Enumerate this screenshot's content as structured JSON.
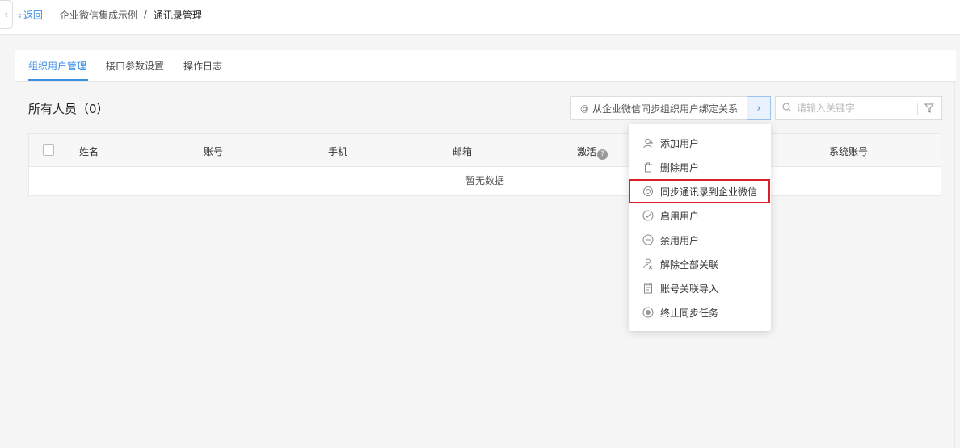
{
  "header": {
    "side_toggle": "‹",
    "back_icon": "‹",
    "back_label": "返回",
    "breadcrumb": [
      "企业微信集成示例",
      "/",
      "通讯录管理"
    ]
  },
  "tabs": [
    "组织用户管理",
    "接口参数设置",
    "操作日志"
  ],
  "section_title": "所有人员（0）",
  "sync_button": {
    "icon": "@",
    "label": "从企业微信同步组织用户绑定关系",
    "arrow": "›"
  },
  "search": {
    "placeholder": "请输入关键字"
  },
  "table": {
    "columns": [
      "姓名",
      "账号",
      "手机",
      "邮箱",
      "激活",
      "系统账号"
    ],
    "help_icon": "?",
    "empty_text": "暂无数据"
  },
  "dropdown": {
    "items": [
      {
        "icon": "user-add-icon",
        "label": "添加用户"
      },
      {
        "icon": "trash-icon",
        "label": "删除用户"
      },
      {
        "icon": "sync-icon",
        "label": "同步通讯录到企业微信",
        "highlighted": true
      },
      {
        "icon": "check-circle-icon",
        "label": "启用用户"
      },
      {
        "icon": "minus-circle-icon",
        "label": "禁用用户"
      },
      {
        "icon": "unlink-icon",
        "label": "解除全部关联"
      },
      {
        "icon": "import-icon",
        "label": "账号关联导入"
      },
      {
        "icon": "stop-icon",
        "label": "终止同步任务"
      }
    ]
  },
  "colors": {
    "accent": "#3a8ee6",
    "highlight_border": "#d9202a"
  }
}
